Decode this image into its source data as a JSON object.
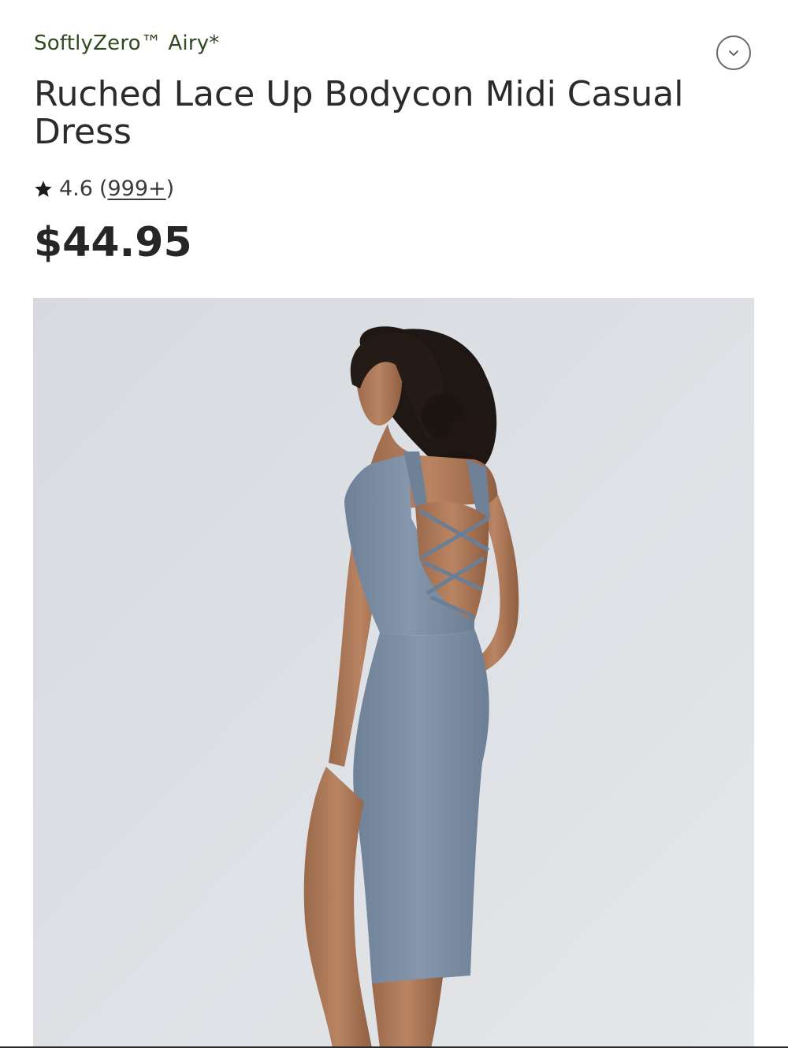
{
  "product": {
    "collection": "SoftlyZero™ Airy*",
    "title": "Ruched Lace Up Bodycon Midi Casual Dress",
    "rating": "4.6",
    "review_count": "999+",
    "price": "$44.95"
  },
  "icons": {
    "expand": "chevron-down-icon",
    "rating": "star-icon"
  },
  "colors": {
    "collection_text": "#2f4a22",
    "title_text": "#2b2b2b",
    "dress": "#7d8ea3",
    "image_background": "#dde0e4"
  }
}
